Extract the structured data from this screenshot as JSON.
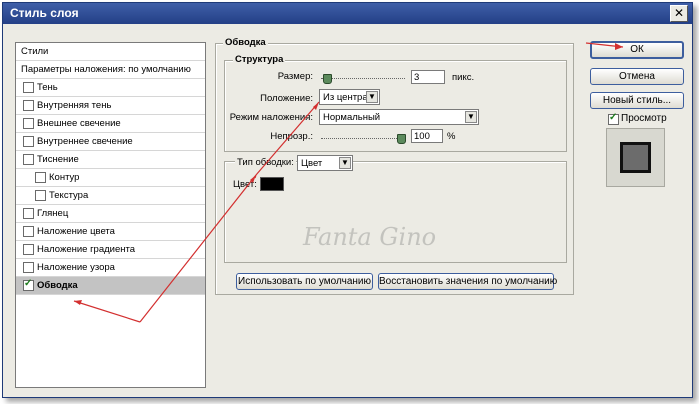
{
  "window": {
    "title": "Стиль слоя",
    "close_glyph": "✕"
  },
  "styles_panel": {
    "header": "Стили",
    "blending": "Параметры наложения: по умолчанию",
    "items": [
      {
        "label": "Тень",
        "checked": false,
        "indent": false
      },
      {
        "label": "Внутренняя тень",
        "checked": false,
        "indent": false
      },
      {
        "label": "Внешнее свечение",
        "checked": false,
        "indent": false
      },
      {
        "label": "Внутреннее свечение",
        "checked": false,
        "indent": false
      },
      {
        "label": "Тиснение",
        "checked": false,
        "indent": false
      },
      {
        "label": "Контур",
        "checked": false,
        "indent": true
      },
      {
        "label": "Текстура",
        "checked": false,
        "indent": true
      },
      {
        "label": "Глянец",
        "checked": false,
        "indent": false
      },
      {
        "label": "Наложение цвета",
        "checked": false,
        "indent": false
      },
      {
        "label": "Наложение градиента",
        "checked": false,
        "indent": false
      },
      {
        "label": "Наложение узора",
        "checked": false,
        "indent": false
      },
      {
        "label": "Обводка",
        "checked": true,
        "indent": false,
        "selected": true
      }
    ]
  },
  "stroke": {
    "group_title": "Обводка",
    "structure_title": "Структура",
    "size_label": "Размер:",
    "size_value": "3",
    "size_unit": "пикс.",
    "position_label": "Положение:",
    "position_value": "Из центра",
    "blend_label": "Режим наложения:",
    "blend_value": "Нормальный",
    "opacity_label": "Непрозр.:",
    "opacity_value": "100",
    "opacity_unit": "%",
    "size_fraction": 0.03,
    "opacity_fraction": 1.0,
    "fill_type_label": "Тип обводки:",
    "fill_type_value": "Цвет",
    "color_label": "Цвет:",
    "color_value": "#000000"
  },
  "bottom_buttons": {
    "make_default": "Использовать по умолчанию",
    "reset_default": "Восстановить значения по умолчанию"
  },
  "side_buttons": {
    "ok": "ОК",
    "cancel": "Отмена",
    "new_style": "Новый стиль...",
    "preview_label": "Просмотр",
    "preview_checked": true
  },
  "watermark": {
    "line1": "Fanta Gino"
  },
  "colors": {
    "title_bar": "#2b4a90",
    "annotation_arrow": "#d33030",
    "selected_row": "#c3c3c3"
  }
}
